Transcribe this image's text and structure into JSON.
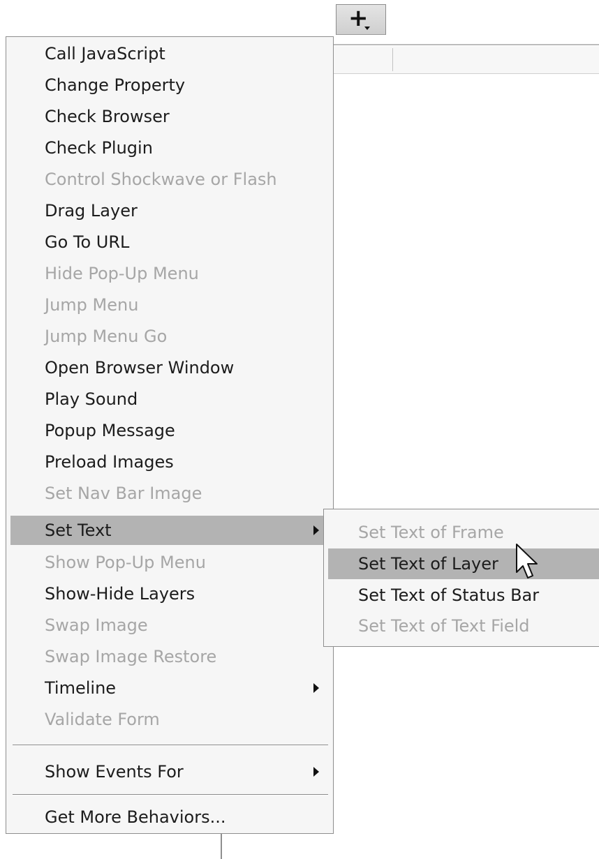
{
  "toolbar": {
    "add_button_label": "+",
    "add_button_icon": "dropdown-caret-icon"
  },
  "menu": {
    "items": [
      {
        "label": "Call JavaScript",
        "enabled": true
      },
      {
        "label": "Change Property",
        "enabled": true
      },
      {
        "label": "Check Browser",
        "enabled": true
      },
      {
        "label": "Check Plugin",
        "enabled": true
      },
      {
        "label": "Control Shockwave or Flash",
        "enabled": false
      },
      {
        "label": "Drag Layer",
        "enabled": true
      },
      {
        "label": "Go To URL",
        "enabled": true
      },
      {
        "label": "Hide Pop-Up Menu",
        "enabled": false
      },
      {
        "label": "Jump Menu",
        "enabled": false
      },
      {
        "label": "Jump Menu Go",
        "enabled": false
      },
      {
        "label": "Open Browser Window",
        "enabled": true
      },
      {
        "label": "Play Sound",
        "enabled": true
      },
      {
        "label": "Popup Message",
        "enabled": true
      },
      {
        "label": "Preload Images",
        "enabled": true
      },
      {
        "label": "Set Nav Bar Image",
        "enabled": false
      },
      {
        "label": "Set Text",
        "enabled": true,
        "submenu": true,
        "highlighted": true
      },
      {
        "label": "Show Pop-Up Menu",
        "enabled": false
      },
      {
        "label": "Show-Hide Layers",
        "enabled": true
      },
      {
        "label": "Swap Image",
        "enabled": false
      },
      {
        "label": "Swap Image Restore",
        "enabled": false
      },
      {
        "label": "Timeline",
        "enabled": true,
        "submenu": true
      },
      {
        "label": "Validate Form",
        "enabled": false
      }
    ],
    "show_events_for": {
      "label": "Show Events For",
      "enabled": true,
      "submenu": true
    },
    "get_more_behaviors": {
      "label": "Get More Behaviors...",
      "enabled": true
    }
  },
  "submenu": {
    "items": [
      {
        "label": "Set Text of Frame",
        "enabled": false
      },
      {
        "label": "Set Text of Layer",
        "enabled": true,
        "highlighted": true
      },
      {
        "label": "Set Text of Status Bar",
        "enabled": true
      },
      {
        "label": "Set Text of Text Field",
        "enabled": false
      }
    ]
  },
  "colors": {
    "menu_background": "#f6f6f6",
    "highlight": "#b3b3b3",
    "disabled_text": "#a6a6a6",
    "text": "#1c1c1c",
    "border": "#8e8e8e"
  }
}
